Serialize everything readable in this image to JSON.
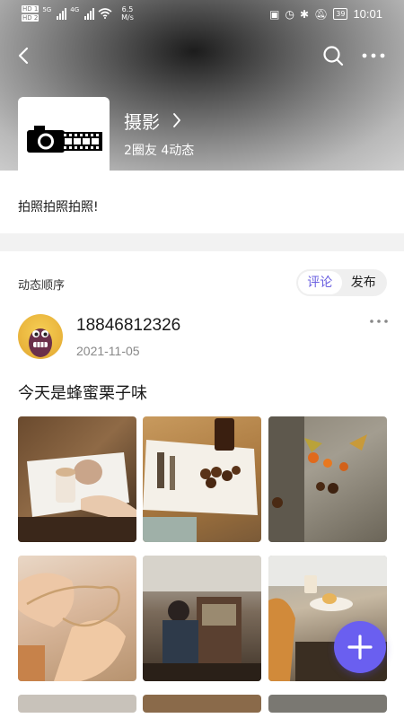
{
  "status_bar": {
    "sim_tag_1": "HD 1",
    "sim_tag_2": "HD 2",
    "signal_1": "5G",
    "signal_2": "4G",
    "speed_value": "6.5",
    "speed_unit": "M/s",
    "battery": "39",
    "time": "10:01"
  },
  "circle": {
    "name": "摄影",
    "stats": "2圈友 4动态",
    "description": "拍照拍照拍照!"
  },
  "feed": {
    "sort_label": "动态顺序",
    "sort_options": [
      "评论",
      "发布"
    ],
    "active_sort": "评论"
  },
  "post": {
    "username": "18846812326",
    "date": "2021-11-05",
    "text": "今天是蜂蜜栗子味",
    "photos": [
      "latte-magazine-photo",
      "magazine-chestnuts-coffee-photo",
      "autumn-leaves-chestnuts-photo",
      "hands-string-photo",
      "cafe-counter-photo",
      "cafe-table-dessert-photo",
      "photo-7",
      "photo-8",
      "photo-9"
    ]
  },
  "colors": {
    "accent": "#6a5ff0",
    "active_segment_text": "#6a5fe0"
  }
}
